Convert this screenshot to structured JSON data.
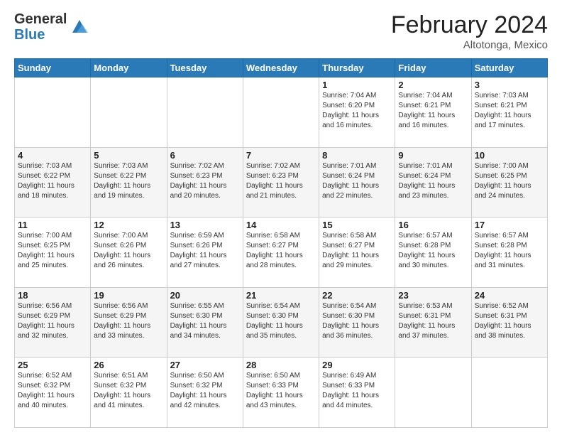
{
  "logo": {
    "general": "General",
    "blue": "Blue"
  },
  "header": {
    "month": "February 2024",
    "location": "Altotonga, Mexico"
  },
  "weekdays": [
    "Sunday",
    "Monday",
    "Tuesday",
    "Wednesday",
    "Thursday",
    "Friday",
    "Saturday"
  ],
  "weeks": [
    [
      {
        "num": "",
        "info": ""
      },
      {
        "num": "",
        "info": ""
      },
      {
        "num": "",
        "info": ""
      },
      {
        "num": "",
        "info": ""
      },
      {
        "num": "1",
        "info": "Sunrise: 7:04 AM\nSunset: 6:20 PM\nDaylight: 11 hours\nand 16 minutes."
      },
      {
        "num": "2",
        "info": "Sunrise: 7:04 AM\nSunset: 6:21 PM\nDaylight: 11 hours\nand 16 minutes."
      },
      {
        "num": "3",
        "info": "Sunrise: 7:03 AM\nSunset: 6:21 PM\nDaylight: 11 hours\nand 17 minutes."
      }
    ],
    [
      {
        "num": "4",
        "info": "Sunrise: 7:03 AM\nSunset: 6:22 PM\nDaylight: 11 hours\nand 18 minutes."
      },
      {
        "num": "5",
        "info": "Sunrise: 7:03 AM\nSunset: 6:22 PM\nDaylight: 11 hours\nand 19 minutes."
      },
      {
        "num": "6",
        "info": "Sunrise: 7:02 AM\nSunset: 6:23 PM\nDaylight: 11 hours\nand 20 minutes."
      },
      {
        "num": "7",
        "info": "Sunrise: 7:02 AM\nSunset: 6:23 PM\nDaylight: 11 hours\nand 21 minutes."
      },
      {
        "num": "8",
        "info": "Sunrise: 7:01 AM\nSunset: 6:24 PM\nDaylight: 11 hours\nand 22 minutes."
      },
      {
        "num": "9",
        "info": "Sunrise: 7:01 AM\nSunset: 6:24 PM\nDaylight: 11 hours\nand 23 minutes."
      },
      {
        "num": "10",
        "info": "Sunrise: 7:00 AM\nSunset: 6:25 PM\nDaylight: 11 hours\nand 24 minutes."
      }
    ],
    [
      {
        "num": "11",
        "info": "Sunrise: 7:00 AM\nSunset: 6:25 PM\nDaylight: 11 hours\nand 25 minutes."
      },
      {
        "num": "12",
        "info": "Sunrise: 7:00 AM\nSunset: 6:26 PM\nDaylight: 11 hours\nand 26 minutes."
      },
      {
        "num": "13",
        "info": "Sunrise: 6:59 AM\nSunset: 6:26 PM\nDaylight: 11 hours\nand 27 minutes."
      },
      {
        "num": "14",
        "info": "Sunrise: 6:58 AM\nSunset: 6:27 PM\nDaylight: 11 hours\nand 28 minutes."
      },
      {
        "num": "15",
        "info": "Sunrise: 6:58 AM\nSunset: 6:27 PM\nDaylight: 11 hours\nand 29 minutes."
      },
      {
        "num": "16",
        "info": "Sunrise: 6:57 AM\nSunset: 6:28 PM\nDaylight: 11 hours\nand 30 minutes."
      },
      {
        "num": "17",
        "info": "Sunrise: 6:57 AM\nSunset: 6:28 PM\nDaylight: 11 hours\nand 31 minutes."
      }
    ],
    [
      {
        "num": "18",
        "info": "Sunrise: 6:56 AM\nSunset: 6:29 PM\nDaylight: 11 hours\nand 32 minutes."
      },
      {
        "num": "19",
        "info": "Sunrise: 6:56 AM\nSunset: 6:29 PM\nDaylight: 11 hours\nand 33 minutes."
      },
      {
        "num": "20",
        "info": "Sunrise: 6:55 AM\nSunset: 6:30 PM\nDaylight: 11 hours\nand 34 minutes."
      },
      {
        "num": "21",
        "info": "Sunrise: 6:54 AM\nSunset: 6:30 PM\nDaylight: 11 hours\nand 35 minutes."
      },
      {
        "num": "22",
        "info": "Sunrise: 6:54 AM\nSunset: 6:30 PM\nDaylight: 11 hours\nand 36 minutes."
      },
      {
        "num": "23",
        "info": "Sunrise: 6:53 AM\nSunset: 6:31 PM\nDaylight: 11 hours\nand 37 minutes."
      },
      {
        "num": "24",
        "info": "Sunrise: 6:52 AM\nSunset: 6:31 PM\nDaylight: 11 hours\nand 38 minutes."
      }
    ],
    [
      {
        "num": "25",
        "info": "Sunrise: 6:52 AM\nSunset: 6:32 PM\nDaylight: 11 hours\nand 40 minutes."
      },
      {
        "num": "26",
        "info": "Sunrise: 6:51 AM\nSunset: 6:32 PM\nDaylight: 11 hours\nand 41 minutes."
      },
      {
        "num": "27",
        "info": "Sunrise: 6:50 AM\nSunset: 6:32 PM\nDaylight: 11 hours\nand 42 minutes."
      },
      {
        "num": "28",
        "info": "Sunrise: 6:50 AM\nSunset: 6:33 PM\nDaylight: 11 hours\nand 43 minutes."
      },
      {
        "num": "29",
        "info": "Sunrise: 6:49 AM\nSunset: 6:33 PM\nDaylight: 11 hours\nand 44 minutes."
      },
      {
        "num": "",
        "info": ""
      },
      {
        "num": "",
        "info": ""
      }
    ]
  ]
}
